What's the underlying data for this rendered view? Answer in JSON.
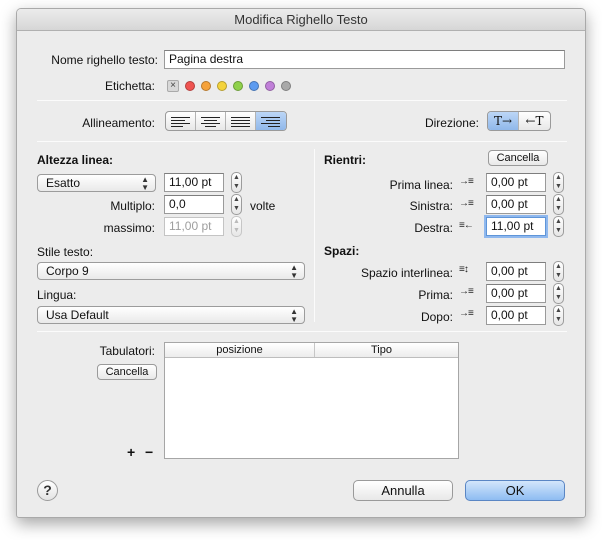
{
  "window": {
    "title": "Modifica Righello Testo"
  },
  "name_row": {
    "label": "Nome righello testo:",
    "value": "Pagina destra"
  },
  "tag_row": {
    "label": "Etichetta:",
    "none_glyph": "×",
    "colors": [
      "#ef5350",
      "#f5a23b",
      "#f4d33c",
      "#8fd14b",
      "#5c9bf0",
      "#c07fd8",
      "#a9a9a9"
    ]
  },
  "alignment": {
    "label": "Allineamento:",
    "options": [
      "left",
      "center",
      "justify",
      "right"
    ],
    "selected": "right"
  },
  "direction": {
    "label": "Direzione:",
    "ltr": "T→",
    "rtl": "←T",
    "selected": "ltr"
  },
  "line_height": {
    "title": "Altezza linea:",
    "mode": "Esatto",
    "value": "11,00 pt",
    "multiple_label": "Multiplo:",
    "multiple_value": "0,0",
    "multiple_unit": "volte",
    "max_label": "massimo:",
    "max_value": "11,00 pt"
  },
  "text_style": {
    "label": "Stile testo:",
    "value": "Corpo 9"
  },
  "language": {
    "label": "Lingua:",
    "value": "Usa Default"
  },
  "indents": {
    "title": "Rientri:",
    "cancel": "Cancella",
    "first_label": "Prima linea:",
    "first_value": "0,00 pt",
    "left_label": "Sinistra:",
    "left_value": "0,00 pt",
    "right_label": "Destra:",
    "right_value": "11,00 pt"
  },
  "spacing": {
    "title": "Spazi:",
    "line_label": "Spazio interlinea:",
    "line_value": "0,00 pt",
    "before_label": "Prima:",
    "before_value": "0,00 pt",
    "after_label": "Dopo:",
    "after_value": "0,00 pt"
  },
  "tabs": {
    "label": "Tabulatori:",
    "cancel": "Cancella",
    "col_position": "posizione",
    "col_type": "Tipo",
    "add": "+",
    "remove": "−"
  },
  "footer": {
    "help": "?",
    "cancel": "Annulla",
    "ok": "OK"
  }
}
